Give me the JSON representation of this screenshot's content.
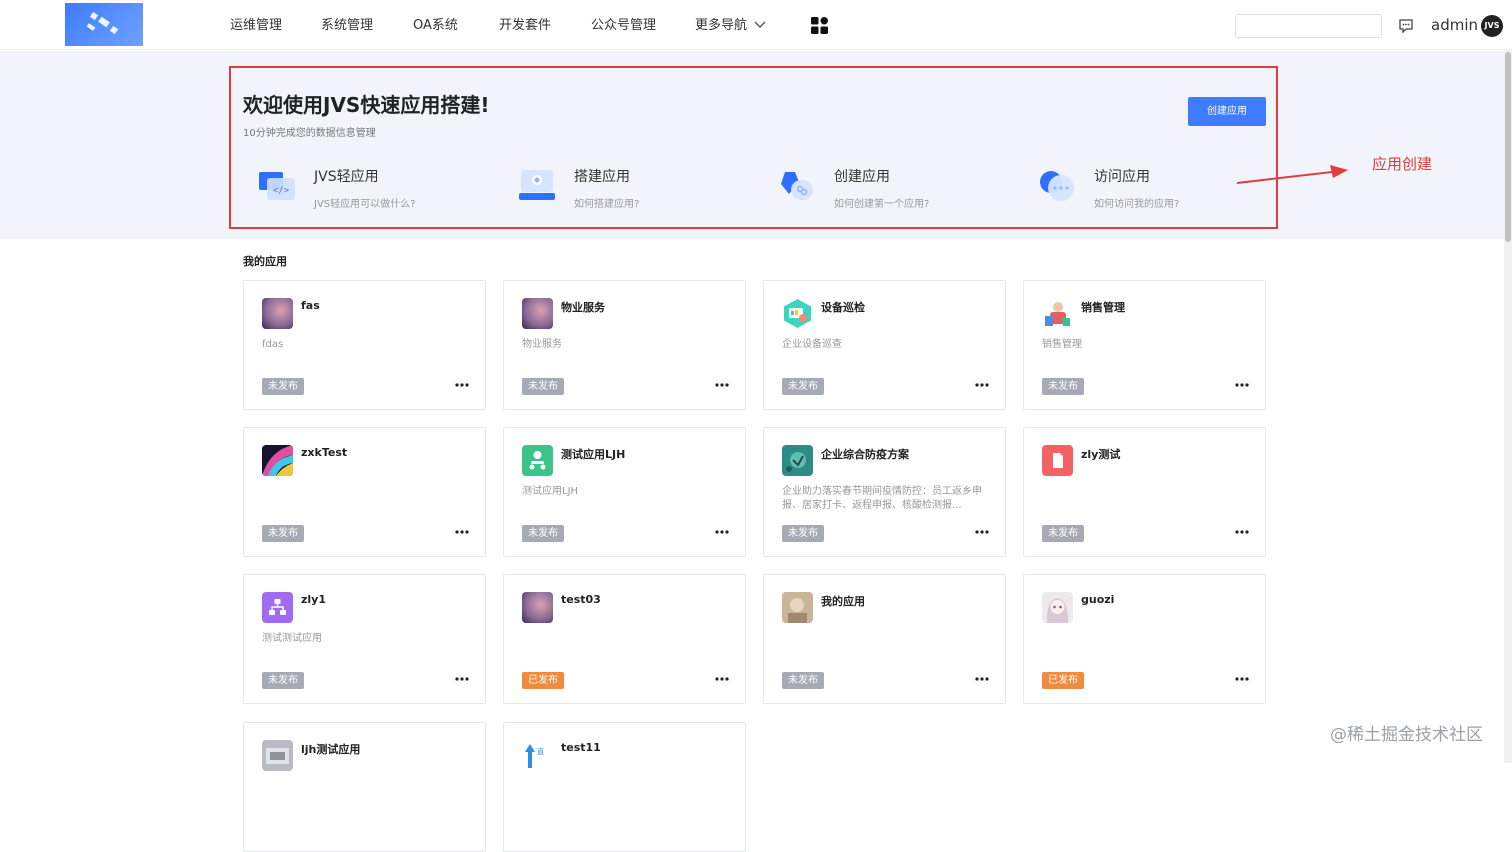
{
  "nav": {
    "items": [
      "运维管理",
      "系统管理",
      "OA系统",
      "开发套件",
      "公众号管理",
      "更多导航"
    ],
    "search_value": "",
    "user_name": "admin",
    "avatar_text": "JVS"
  },
  "banner": {
    "title": "欢迎使用JVS快速应用搭建!",
    "subtitle": "10分钟完成您的数据信息管理",
    "create_button": "创建应用",
    "features": [
      {
        "title": "JVS轻应用",
        "desc": "JVS轻应用可以做什么?",
        "icon": "code-window-icon"
      },
      {
        "title": "搭建应用",
        "desc": "如何搭建应用?",
        "icon": "monitor-icon"
      },
      {
        "title": "创建应用",
        "desc": "如何创建第一个应用?",
        "icon": "link-cube-icon"
      },
      {
        "title": "访问应用",
        "desc": "如何访问我的应用?",
        "icon": "chat-bubble-icon"
      }
    ]
  },
  "annotation": {
    "label": "应用创建",
    "color": "#e23d3d"
  },
  "apps": {
    "section_title": "我的应用",
    "status_colors": {
      "unpublished": "#a5aab5",
      "published": "#f08a3c"
    },
    "items": [
      {
        "name": "fas",
        "desc": "fdas",
        "status": "未发布",
        "published": false,
        "icon": "gradient-purple-icon"
      },
      {
        "name": "物业服务",
        "desc": "物业服务",
        "status": "未发布",
        "published": false,
        "icon": "gradient-purple-icon"
      },
      {
        "name": "设备巡检",
        "desc": "企业设备巡查",
        "status": "未发布",
        "published": false,
        "icon": "device-hexagon-icon"
      },
      {
        "name": "销售管理",
        "desc": "销售管理",
        "status": "未发布",
        "published": false,
        "icon": "sales-illustration-icon"
      },
      {
        "name": "zxkTest",
        "desc": "",
        "status": "未发布",
        "published": false,
        "icon": "colorful-abstract-icon"
      },
      {
        "name": "测试应用LJH",
        "desc": "测试应用LJH",
        "status": "未发布",
        "published": false,
        "icon": "green-people-icon"
      },
      {
        "name": "企业综合防疫方案",
        "desc": "企业助力落实春节期间疫情防控：员工返乡申报、居家打卡、返程申报、核酸检测报...",
        "status": "未发布",
        "published": false,
        "icon": "teal-photo-icon"
      },
      {
        "name": "zly测试",
        "desc": "",
        "status": "未发布",
        "published": false,
        "icon": "red-document-icon"
      },
      {
        "name": "zly1",
        "desc": "测试测试应用",
        "status": "未发布",
        "published": false,
        "icon": "purple-network-icon"
      },
      {
        "name": "test03",
        "desc": "",
        "status": "已发布",
        "published": true,
        "icon": "gradient-purple-icon"
      },
      {
        "name": "我的应用",
        "desc": "",
        "status": "未发布",
        "published": false,
        "icon": "beige-photo-icon"
      },
      {
        "name": "guozi",
        "desc": "",
        "status": "已发布",
        "published": true,
        "icon": "anime-photo-icon"
      },
      {
        "name": "ljh测试应用",
        "desc": "",
        "status": "",
        "published": false,
        "icon": "grey-photo-icon"
      },
      {
        "name": "test11",
        "desc": "",
        "status": "",
        "published": false,
        "icon": "blue-arrow-logo-icon"
      }
    ]
  },
  "watermark": "@稀土掘金技术社区"
}
